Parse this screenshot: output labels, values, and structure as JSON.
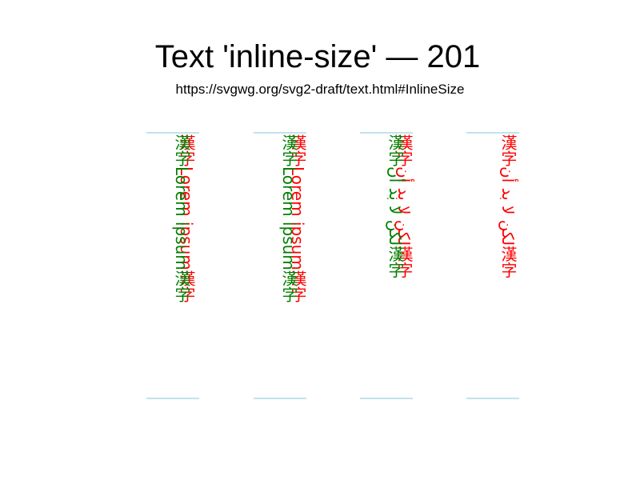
{
  "title": "Text 'inline-size' — 201",
  "url": "https://svgwg.org/svg2-draft/text.html#InlineSize",
  "colors": {
    "reference": "#ff0000",
    "test": "#008000",
    "guide": "#add8e6"
  },
  "columns": [
    {
      "reference_text": "漢字Lorem ipsum漢字",
      "test_text": "漢字Lorem ipsum漢字"
    },
    {
      "reference_text": "漢字Lorem ipsum漢字",
      "test_text": "漢字Lorem ipsum漢字"
    },
    {
      "reference_text": "漢字لكن لا بد أن漢字",
      "test_text": "漢字لكن لا بد أن漢字"
    },
    {
      "reference_text": "漢字لكن لا بد أن漢字",
      "test_text": ""
    }
  ]
}
